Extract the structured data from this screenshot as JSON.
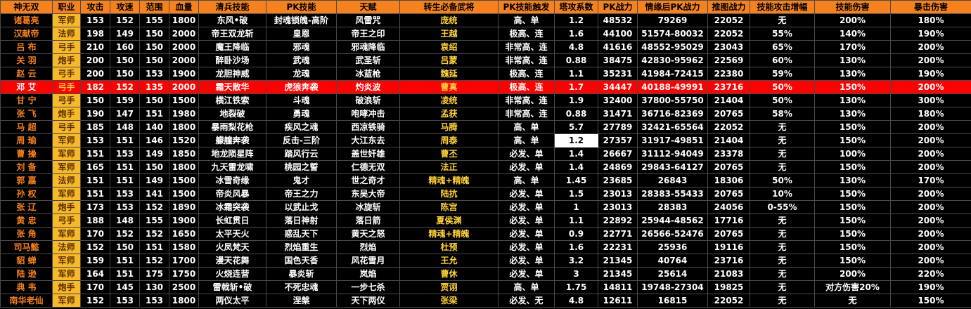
{
  "headers": [
    "神无双",
    "职业",
    "攻击",
    "攻速",
    "范围",
    "血量",
    "清兵技能",
    "PK技能",
    "天赋",
    "转生必备武将",
    "PK技能触发",
    "塔攻系数",
    "PK战力",
    "情缘后PK战力",
    "推图战力",
    "技能攻击增幅",
    "技能伤害",
    "暴击伤害"
  ],
  "rows": [
    [
      "诸葛亮",
      "军师",
      "153",
      "152",
      "155",
      "1800",
      "东风•破",
      "封魂锁魄-高阶",
      "风雷咒",
      "庞统",
      "高、单",
      "1.2",
      "48532",
      "79269",
      "22052",
      "无",
      "200%",
      "180%"
    ],
    [
      "汉献帝",
      "法师",
      "198",
      "149",
      "150",
      "2000",
      "帝王双龙斩",
      "皇恩",
      "帝王之印",
      "王越",
      "极高、连",
      "1.6",
      "44100",
      "51574-80032",
      "22052",
      "55%",
      "140%",
      "190%"
    ],
    [
      "吕 布",
      "弓手",
      "210",
      "160",
      "150",
      "2000",
      "魔王降临",
      "邪魂",
      "邪魂降临",
      "袁绍",
      "非常高、连",
      "4.8",
      "41616",
      "48552-95029",
      "23043",
      "65%",
      "170%",
      "200%"
    ],
    [
      "关 羽",
      "炮手",
      "200",
      "150",
      "150",
      "2000",
      "醉卧沙场",
      "武魂",
      "武圣斩",
      "吕蒙",
      "非常高、连",
      "0.88",
      "38475",
      "42830-95962",
      "22569",
      "60%",
      "130%",
      "200%"
    ],
    [
      "赵 云",
      "弓手",
      "200",
      "150",
      "153",
      "1900",
      "龙胆神威",
      "龙魂",
      "冰蓝枪",
      "魏延",
      "极高、连",
      "1.1",
      "35231",
      "41984-72415",
      "22380",
      "59%",
      "130%",
      "190%"
    ],
    [
      "邓 艾",
      "弓手",
      "182",
      "152",
      "135",
      "2000",
      "霜天散华",
      "虎狼奔袭",
      "灼炎波",
      "曹真",
      "极高、连",
      "1.7",
      "34447",
      "40188-49991",
      "23716",
      "50%",
      "150%",
      "200%"
    ],
    [
      "甘 宁",
      "弓手",
      "150",
      "159",
      "150",
      "1500",
      "横江铁索",
      "斗魂",
      "破浪斩",
      "凌统",
      "非常高、连",
      "1.9",
      "32400",
      "37800-55750",
      "21404",
      "50%",
      "130%",
      "300%"
    ],
    [
      "张 飞",
      "炮手",
      "190",
      "147",
      "151",
      "1980",
      "地裂破",
      "勇魂",
      "咆哮冲击",
      "孟获",
      "非常高、连",
      "0.88",
      "31471",
      "36716-82369",
      "20765",
      "58%",
      "130%",
      "180%"
    ],
    [
      "马 超",
      "弓手",
      "185",
      "148",
      "140",
      "1800",
      "暴雨梨花枪",
      "疾风之魂",
      "西凉铁骑",
      "马腾",
      "高、单",
      "5.7",
      "27789",
      "32421-65564",
      "22052",
      "无",
      "150%",
      "200%"
    ],
    [
      "周 瑜",
      "军师",
      "153",
      "151",
      "146",
      "1520",
      "艨艟奔袭",
      "反击-三阶",
      "大江东去",
      "周泰",
      "高、单",
      "1.2",
      "27357",
      "31917-49851",
      "21404",
      "无",
      "150%",
      "200%"
    ],
    [
      "曹 操",
      "军师",
      "151",
      "153",
      "149",
      "1850",
      "地龙陨星阵",
      "踏风行云",
      "盖世奸雄",
      "曹丕",
      "必发、单",
      "1.4",
      "26667",
      "31112-94049",
      "23378",
      "无",
      "100%",
      "200%"
    ],
    [
      "刘 备",
      "军师",
      "165",
      "151",
      "150",
      "1800",
      "九天雷龙啸",
      "桃园之誓",
      "仁德无双",
      "法正",
      "必发、单",
      "1.4",
      "24869",
      "29843-64127",
      "20765",
      "无",
      "150%",
      "200%"
    ],
    [
      "郭 嘉",
      "法师",
      "151",
      "151",
      "149",
      "1500",
      "冰雪奇缘",
      "鬼才",
      "世之奇才",
      "精魂+精魄",
      "高、单",
      "1.45",
      "23685",
      "26843",
      "18306",
      "50%",
      "130%",
      "170%"
    ],
    [
      "孙 权",
      "军师",
      "151",
      "153",
      "141",
      "1500",
      "帝炎风暴",
      "帝王之力",
      "东吴大帝",
      "陆抗",
      "必发、单",
      "1.5",
      "23013",
      "28383-55433",
      "20765",
      "10%",
      "150%",
      "200%"
    ],
    [
      "张 辽",
      "炮手",
      "173",
      "153",
      "152",
      "1890",
      "冰霜突袭",
      "以武止戈",
      "冰旋斩",
      "陈宫",
      "必发、单",
      "1",
      "23013",
      "28383",
      "24056",
      "0-55%",
      "150%",
      "200%"
    ],
    [
      "黄 忠",
      "弓手",
      "188",
      "148",
      "155",
      "1900",
      "长虹贯日",
      "落日神射",
      "落日箭",
      "夏侯渊",
      "必发、单",
      "1.1",
      "22892",
      "25944-48562",
      "17716",
      "无",
      "150%",
      "200%"
    ],
    [
      "张 角",
      "军师",
      "170",
      "152",
      "152",
      "1650",
      "太平天火",
      "惑乱天下",
      "黄天之怒",
      "精魂+精魄",
      "必发、单",
      "0.9",
      "22771",
      "26566-52476",
      "20765",
      "无",
      "150%",
      "200%"
    ],
    [
      "司马懿",
      "法师",
      "152",
      "150",
      "151",
      "1580",
      "火凤梵天",
      "烈焰重生",
      "烈焰",
      "杜预",
      "必发、单",
      "1.6",
      "22231",
      "25936",
      "19116",
      "无",
      "150%",
      "200%"
    ],
    [
      "貂 蝉",
      "军师",
      "159",
      "151",
      "152",
      "1700",
      "漫天花舞",
      "国色天香",
      "风花雪月",
      "王允",
      "必发、单",
      "3.2",
      "21345",
      "40764",
      "23716",
      "无",
      "150%",
      "200%"
    ],
    [
      "陆 逊",
      "军师",
      "164",
      "151",
      "175",
      "1750",
      "火烧连营",
      "暴炎斩",
      "岚焰",
      "曹休",
      "必发、单",
      "3",
      "21345",
      "25614",
      "21083",
      "无",
      "200%",
      "220%"
    ],
    [
      "典 韦",
      "炮手",
      "170",
      "145",
      "130",
      "2500",
      "雷戟斩•破",
      "不死忠魂",
      "一步七杀",
      "贾诩",
      "高、单",
      "1.75",
      "14811",
      "19748-27304",
      "19825",
      "无",
      "对方伤害20%",
      "190%"
    ],
    [
      "南华老仙",
      "军师",
      "152",
      "153",
      "153",
      "1800",
      "两仪太平",
      "涅槃",
      "天下两仪",
      "张梁",
      "必发、无",
      "4.8",
      "12611",
      "16815",
      "22052",
      "无",
      "无",
      "150%"
    ]
  ]
}
